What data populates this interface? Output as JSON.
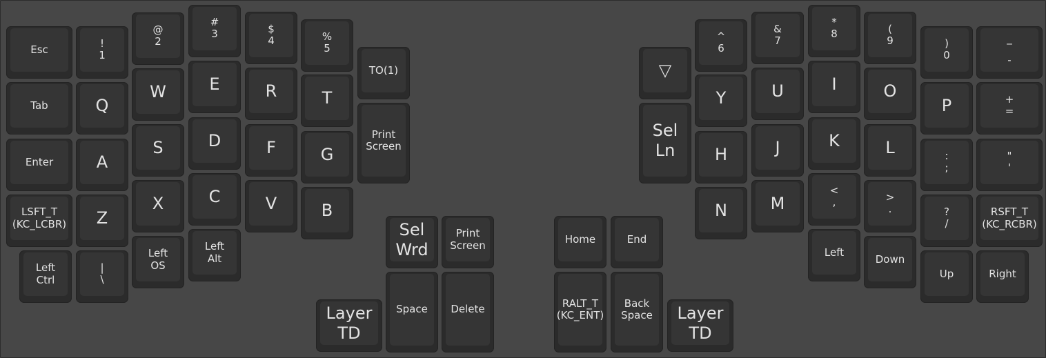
{
  "keys": {
    "esc": "Esc",
    "k1": {
      "shift": "!",
      "base": "1"
    },
    "k2": {
      "shift": "@",
      "base": "2"
    },
    "k3": {
      "shift": "#",
      "base": "3"
    },
    "k4": {
      "shift": "$",
      "base": "4"
    },
    "k5": {
      "shift": "%",
      "base": "5"
    },
    "to1": "TO(1)",
    "tab": "Tab",
    "q": "Q",
    "w": "W",
    "e": "E",
    "r": "R",
    "t": "T",
    "print_screen_l1": "Print",
    "print_screen_l2": "Screen",
    "enter": "Enter",
    "a": "A",
    "s": "S",
    "d": "D",
    "f": "F",
    "g": "G",
    "lsft_l1": "LSFT_T",
    "lsft_l2": "(KC_LCBR)",
    "z": "Z",
    "x": "X",
    "c": "C",
    "v": "V",
    "b": "B",
    "left_ctrl_l1": "Left",
    "left_ctrl_l2": "Ctrl",
    "pipe": {
      "shift": "|",
      "base": "\\"
    },
    "left_os_l1": "Left",
    "left_os_l2": "OS",
    "left_alt_l1": "Left",
    "left_alt_l2": "Alt",
    "sel_wrd_l1": "Sel",
    "sel_wrd_l2": "Wrd",
    "print_screen2_l1": "Print",
    "print_screen2_l2": "Screen",
    "layer_td_l1": "Layer",
    "layer_td_l2": "TD",
    "space": "Space",
    "delete": "Delete",
    "home": "Home",
    "end": "End",
    "ralt_l1": "RALT_T",
    "ralt_l2": "(KC_ENT)",
    "backspace_l1": "Back",
    "backspace_l2": "Space",
    "layer_td_r_l1": "Layer",
    "layer_td_r_l2": "TD",
    "triangle": "▽",
    "sel_ln_l1": "Sel",
    "sel_ln_l2": "Ln",
    "k6": {
      "shift": "^",
      "base": "6"
    },
    "k7": {
      "shift": "&",
      "base": "7"
    },
    "k8": {
      "shift": "*",
      "base": "8"
    },
    "k9": {
      "shift": "(",
      "base": "9"
    },
    "k0": {
      "shift": ")",
      "base": "0"
    },
    "minus": {
      "shift": "_",
      "base": "-"
    },
    "y": "Y",
    "u": "U",
    "i": "I",
    "o": "O",
    "p": "P",
    "equal": {
      "shift": "+",
      "base": "="
    },
    "h": "H",
    "j": "J",
    "k": "K",
    "l": "L",
    "semicolon": {
      "shift": ":",
      "base": ";"
    },
    "quote": {
      "shift": "\"",
      "base": "'"
    },
    "n": "N",
    "m": "M",
    "comma": {
      "shift": "<",
      "base": ","
    },
    "period": {
      "shift": ">",
      "base": "."
    },
    "slash": {
      "shift": "?",
      "base": "/"
    },
    "rsft_l1": "RSFT_T",
    "rsft_l2": "(KC_RCBR)",
    "left": "Left",
    "down": "Down",
    "up": "Up",
    "right": "Right"
  },
  "colors": {
    "background": "#474747",
    "key_border": "#2b2b2b",
    "key_top": "#353535",
    "legend": "#e3e3e3"
  }
}
